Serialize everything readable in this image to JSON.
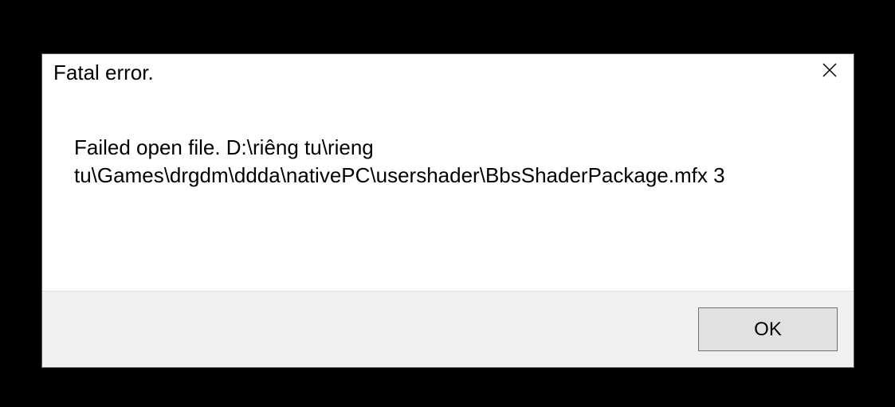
{
  "dialog": {
    "title": "Fatal error.",
    "message": "Failed open file. D:\\riêng tu\\rieng tu\\Games\\drgdm\\ddda\\nativePC\\usershader\\BbsShaderPackage.mfx 3",
    "ok_label": "OK"
  }
}
